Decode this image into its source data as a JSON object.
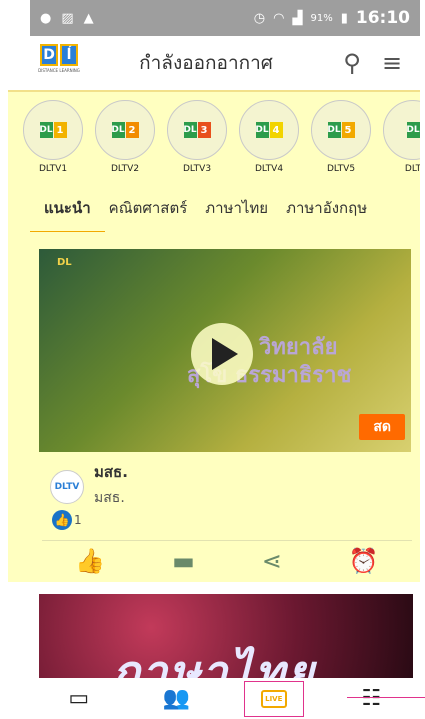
{
  "status_bar": {
    "battery": "91%",
    "time": "16:10"
  },
  "header": {
    "title": "กำลังออกอากาศ",
    "logo_text": "DLTV"
  },
  "channels": [
    {
      "label": "DLTV1",
      "num": "1",
      "color": "#f2b300"
    },
    {
      "label": "DLTV2",
      "num": "2",
      "color": "#f28c00"
    },
    {
      "label": "DLTV3",
      "num": "3",
      "color": "#e8501c"
    },
    {
      "label": "DLTV4",
      "num": "4",
      "color": "#f2d400"
    },
    {
      "label": "DLTV5",
      "num": "5",
      "color": "#f2a900"
    },
    {
      "label": "DLT",
      "num": "",
      "color": "#2d9c4b"
    }
  ],
  "tabs": [
    {
      "label": "แนะนำ"
    },
    {
      "label": "คณิตศาสตร์"
    },
    {
      "label": "ภาษาไทย"
    },
    {
      "label": "ภาษาอังกฤษ"
    }
  ],
  "video": {
    "overlay_line1": "วิทยาลัย",
    "overlay_line2": "สุโข      ธรรมาธิราช",
    "live_label": "สด",
    "corner": "DL"
  },
  "channel_info": {
    "name": "มสธ.",
    "sub": "มสธ.",
    "avatar_text": "DLTV"
  },
  "likes": {
    "count": "1"
  },
  "card2": {
    "title": "ภาษาไทย"
  },
  "bottom_nav": {
    "live_label": "LIVE"
  }
}
